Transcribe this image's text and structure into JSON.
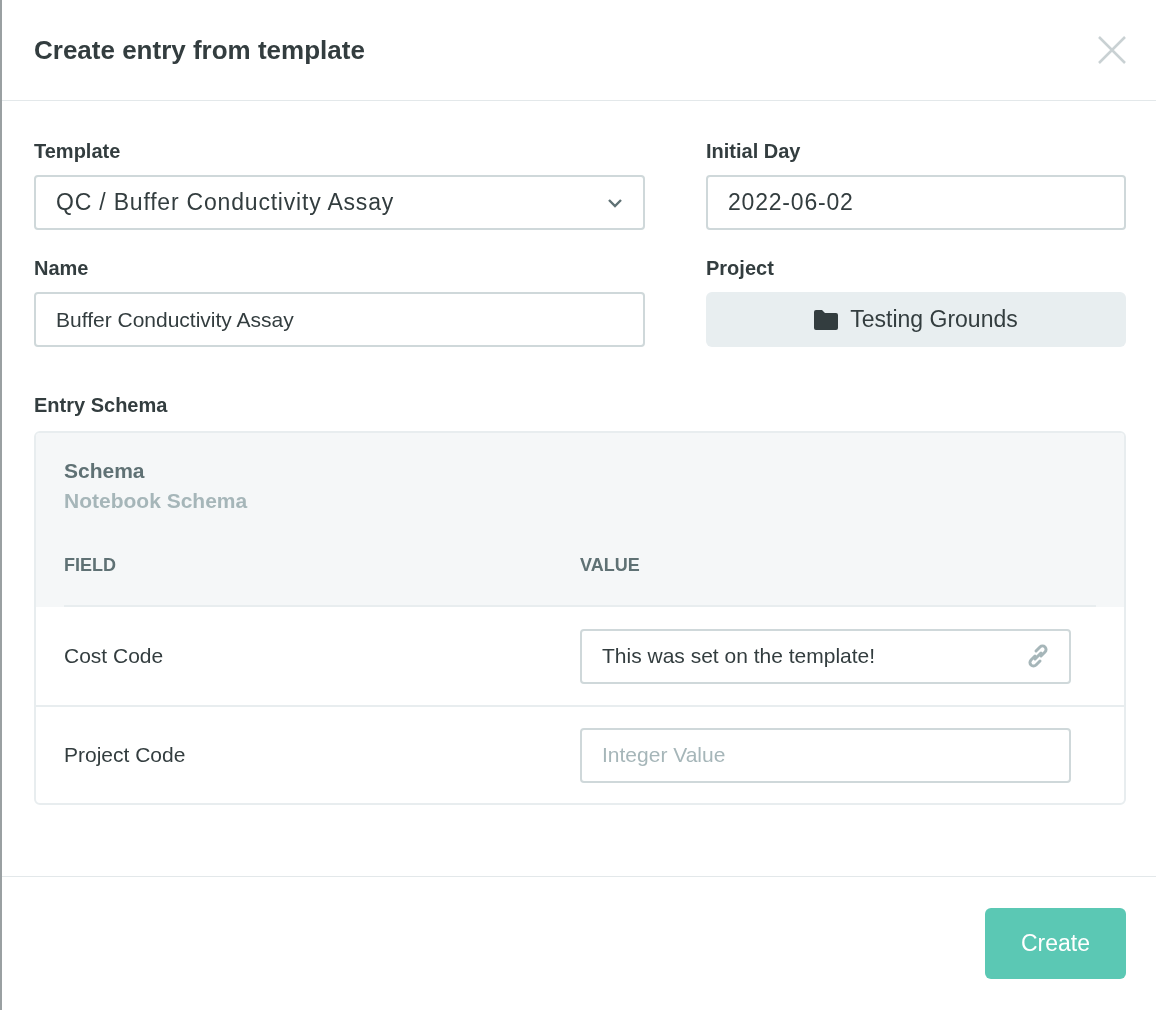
{
  "dialog": {
    "title": "Create entry from template"
  },
  "template": {
    "label": "Template",
    "value": "QC / Buffer Conductivity Assay"
  },
  "initial_day": {
    "label": "Initial Day",
    "value": "2022-06-02"
  },
  "name": {
    "label": "Name",
    "value": "Buffer Conductivity Assay"
  },
  "project": {
    "label": "Project",
    "value": "Testing Grounds"
  },
  "entry_schema": {
    "label": "Entry Schema",
    "title": "Schema",
    "subtitle": "Notebook Schema",
    "columns": [
      "FIELD",
      "VALUE"
    ],
    "rows": [
      {
        "field": "Cost Code",
        "value": "This was set on the template!",
        "linked": true
      },
      {
        "field": "Project Code",
        "placeholder": "Integer Value",
        "linked": false
      }
    ]
  },
  "footer": {
    "button": "Create"
  }
}
